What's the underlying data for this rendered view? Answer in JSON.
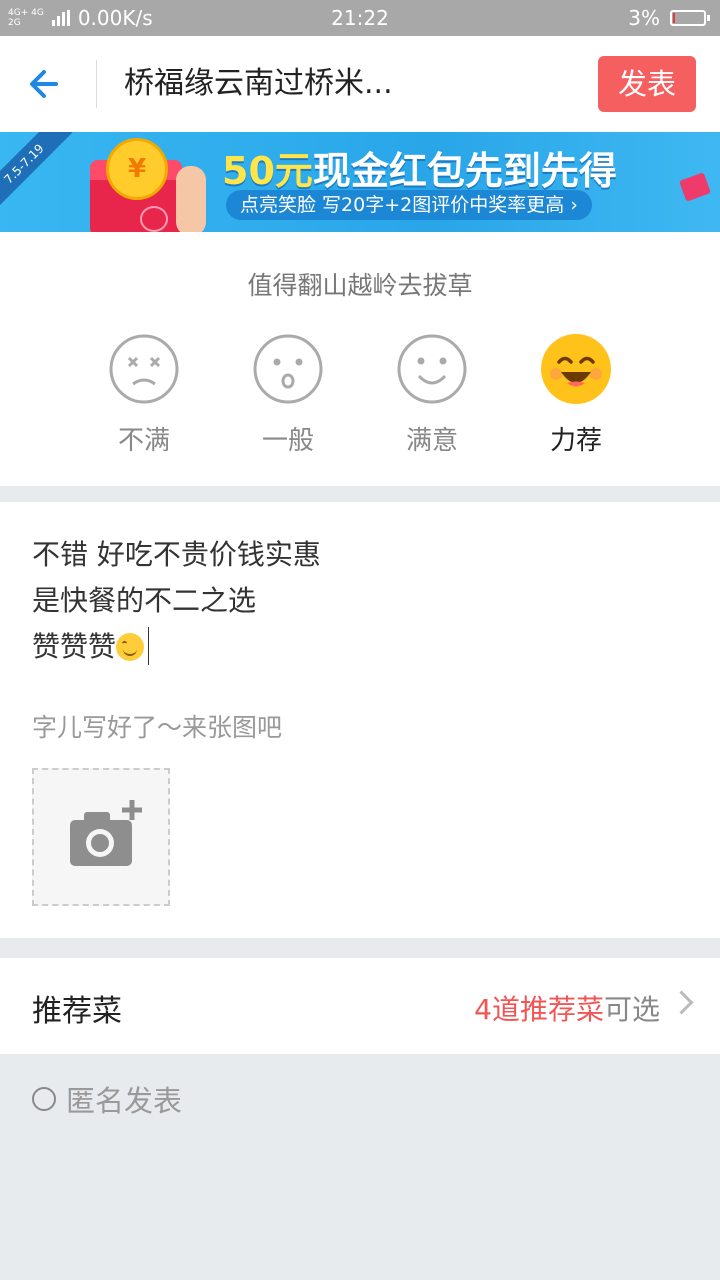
{
  "status_bar": {
    "network_top": "4G+ 4G",
    "network_bottom": "2G",
    "speed": "0.00K/s",
    "time": "21:22",
    "battery_percent": "3%",
    "battery_level": 0.03
  },
  "header": {
    "title": "桥福缘云南过桥米...",
    "publish_label": "发表"
  },
  "banner": {
    "ribbon_text": "7.5-7.19",
    "coin_symbol": "¥",
    "main_number": "50元",
    "main_text": "现金红包先到先得",
    "sub_text": "点亮笑脸 写20字+2图评价中奖率更高 ›"
  },
  "rating": {
    "prompt": "值得翻山越岭去拔草",
    "options": [
      {
        "label": "不满",
        "icon": "dissatisfied-face-icon"
      },
      {
        "label": "一般",
        "icon": "neutral-face-icon"
      },
      {
        "label": "满意",
        "icon": "satisfied-face-icon"
      },
      {
        "label": "力荐",
        "icon": "highly-recommend-face-icon",
        "selected": true
      }
    ],
    "accent_color": "#ffc21a"
  },
  "review": {
    "lines": [
      "不错  好吃不贵价钱实惠",
      "是快餐的不二之选",
      "赞赞赞"
    ],
    "photo_hint": "字儿写好了～来张图吧",
    "add_photo_icon": "camera-plus-icon"
  },
  "dishes": {
    "label": "推荐菜",
    "count_text": "4道推荐菜",
    "suffix": "可选"
  },
  "anonymous": {
    "label": "匿名发表",
    "checked": false
  },
  "colors": {
    "accent_blue": "#1e88e5",
    "publish_red": "#f55f5f",
    "count_red": "#f35555"
  }
}
